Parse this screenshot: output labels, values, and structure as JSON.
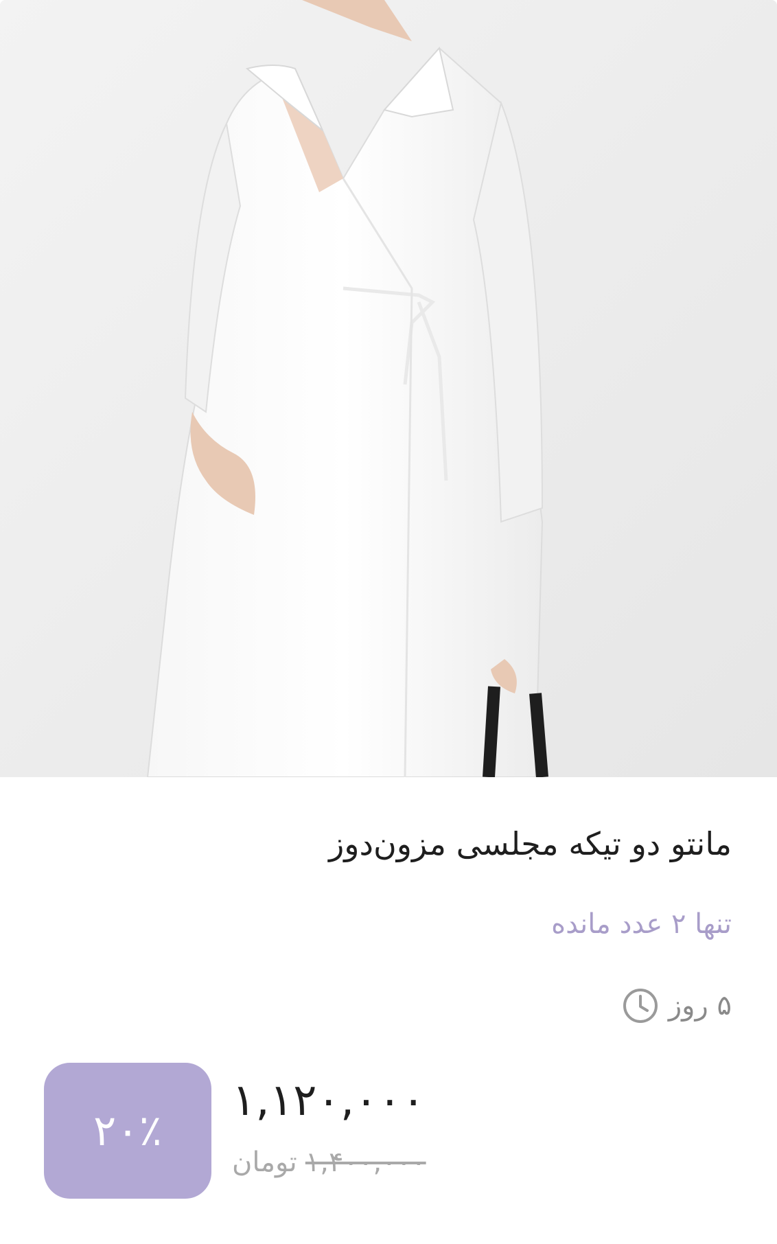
{
  "product": {
    "image_alt": "white wrap maternity dress",
    "title": "مانتو دو تیکه مجلسی مزون‌دوز",
    "stock_note": "تنها ۲ عدد مانده",
    "delivery_text": "۵ روز",
    "delivery_icon": "clock-icon",
    "price_current": "۱,۱۲۰,۰۰۰",
    "price_old": "۱,۴۰۰,۰۰۰",
    "currency": "تومان",
    "discount": "۲۰٪"
  },
  "colors": {
    "accent": "#b2a8d4",
    "stock_text": "#a89dc9",
    "title_text": "#1e1e1e",
    "muted_text": "#a9a9a9"
  }
}
